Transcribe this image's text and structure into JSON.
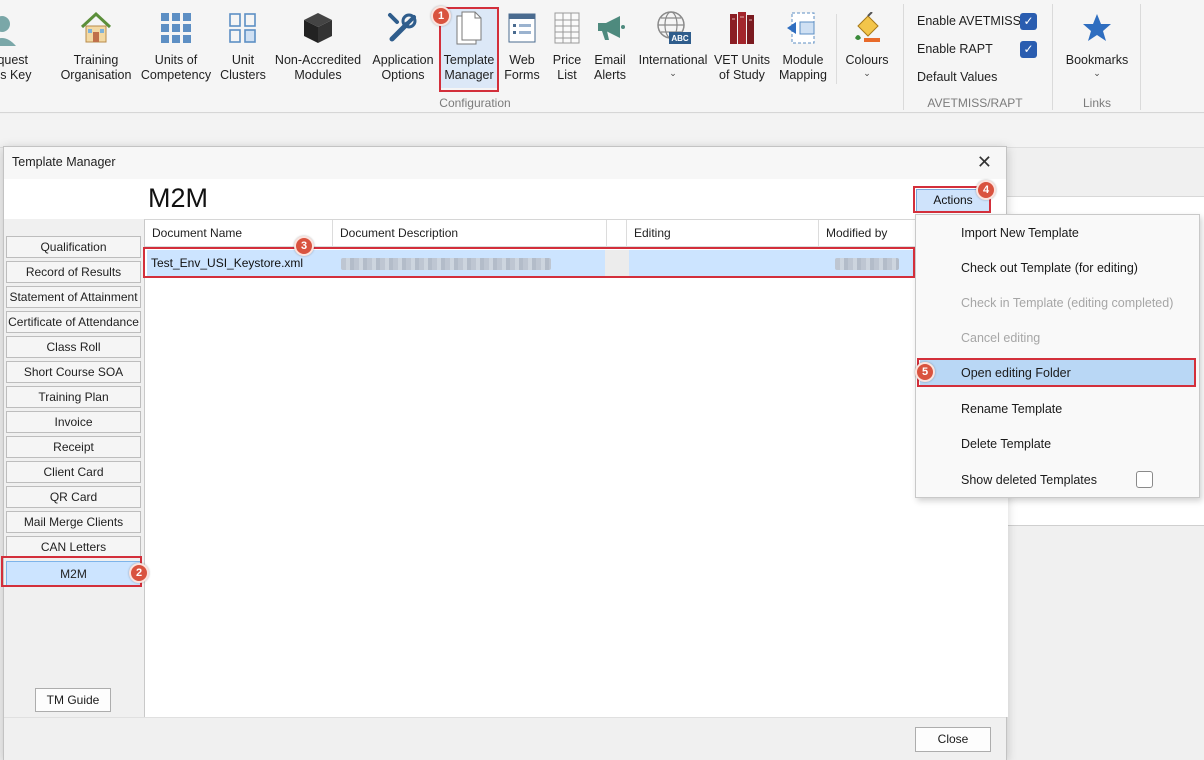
{
  "ribbon": {
    "partial_button": {
      "label": "quest\nss Key"
    },
    "buttons": [
      {
        "id": "training-organisation",
        "label": "Training\nOrganisation",
        "icon": "house-icon"
      },
      {
        "id": "units-of-competency",
        "label": "Units of\nCompetency",
        "icon": "grid-icon"
      },
      {
        "id": "unit-clusters",
        "label": "Unit\nClusters",
        "icon": "cluster-icon"
      },
      {
        "id": "non-accredited-modules",
        "label": "Non-Accredited\nModules",
        "icon": "cube-icon"
      },
      {
        "id": "application-options",
        "label": "Application\nOptions",
        "icon": "tools-icon"
      },
      {
        "id": "template-manager",
        "label": "Template\nManager",
        "icon": "documents-icon"
      },
      {
        "id": "web-forms",
        "label": "Web\nForms",
        "icon": "form-icon"
      },
      {
        "id": "price-list",
        "label": "Price\nList",
        "icon": "sheet-icon"
      },
      {
        "id": "email-alerts",
        "label": "Email\nAlerts",
        "icon": "megaphone-icon"
      },
      {
        "id": "international",
        "label": "International",
        "icon": "globe-abc-icon",
        "abc": "ABC",
        "dropdown": "⌄"
      },
      {
        "id": "vet-units-of-study",
        "label": "VET Units\nof Study",
        "icon": "books-icon"
      },
      {
        "id": "module-mapping",
        "label": "Module\nMapping",
        "icon": "mapping-icon"
      },
      {
        "id": "colours",
        "label": "Colours",
        "icon": "paint-icon",
        "dropdown": "⌄"
      }
    ],
    "group_configuration": "Configuration",
    "avetmiss": {
      "enable_avetmiss": "Enable AVETMISS",
      "enable_rapt": "Enable RAPT",
      "default_values": "Default Values",
      "group_label": "AVETMISS/RAPT",
      "checkmark": "✓"
    },
    "links": {
      "bookmarks": "Bookmarks",
      "dropdown": "⌄",
      "group_label": "Links"
    }
  },
  "dialog": {
    "title": "Template Manager",
    "close_glyph": "✕",
    "heading": "M2M",
    "actions_label": "Actions",
    "sidebar_items": [
      "Qualification",
      "Record of Results",
      "Statement of Attainment",
      "Certificate of Attendance",
      "Class Roll",
      "Short Course SOA",
      "Training Plan",
      "Invoice",
      "Receipt",
      "Client Card",
      "QR Card",
      "Mail Merge Clients",
      "CAN Letters",
      "M2M"
    ],
    "selected_item": "M2M",
    "tm_guide": "TM Guide",
    "table": {
      "columns": [
        "Document Name",
        "Document Description",
        "",
        "Editing",
        "Modified by"
      ],
      "rows": [
        {
          "name": "Test_Env_USI_Keystore.xml",
          "description": "",
          "editing": "",
          "modified_by": ""
        }
      ]
    },
    "close_label": "Close"
  },
  "menu": {
    "items": [
      {
        "label": "Import New Template",
        "enabled": true
      },
      {
        "label": "Check out Template (for editing)",
        "enabled": true
      },
      {
        "label": "Check in Template (editing completed)",
        "enabled": false
      },
      {
        "label": "Cancel editing",
        "enabled": false
      },
      {
        "label": "Open editing Folder",
        "enabled": true,
        "highlighted": true
      },
      {
        "label": "Rename Template",
        "enabled": true
      },
      {
        "label": "Delete Template",
        "enabled": true
      },
      {
        "label": "Show deleted Templates",
        "enabled": true,
        "checkbox": false
      }
    ]
  },
  "annotations": [
    "1",
    "2",
    "3",
    "4",
    "5"
  ],
  "colors": {
    "accent": "#2a5db0",
    "highlight": "#cce4ff",
    "annotation": "#d32f3b",
    "badge": "#d9533f"
  }
}
